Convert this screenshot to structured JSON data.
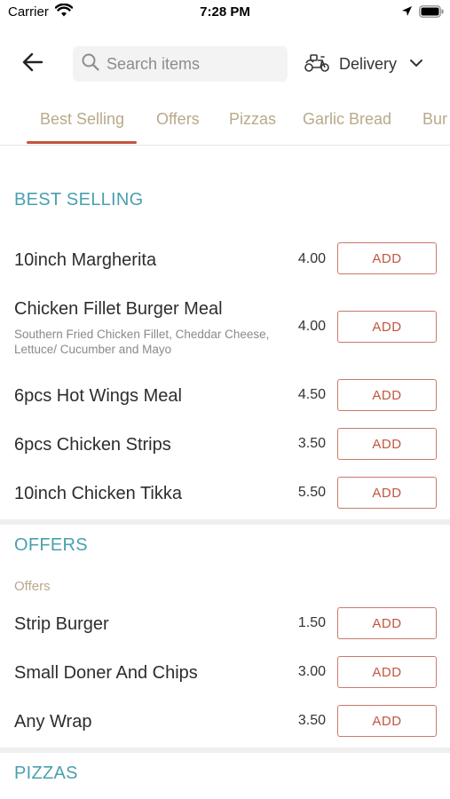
{
  "status_bar": {
    "carrier": "Carrier",
    "time": "7:28 PM",
    "icons": [
      "wifi-icon",
      "location-arrow-icon",
      "battery-icon"
    ]
  },
  "header": {
    "back_icon": "arrow-left-icon",
    "search": {
      "placeholder": "Search items",
      "value": "",
      "icon": "search-icon"
    },
    "delivery": {
      "label": "Delivery",
      "icon": "delivery-scooter-icon",
      "dropdown_icon": "chevron-down-icon"
    }
  },
  "tabs": [
    {
      "label": "Best Selling",
      "active": true
    },
    {
      "label": "Offers",
      "active": false
    },
    {
      "label": "Pizzas",
      "active": false
    },
    {
      "label": "Garlic Bread",
      "active": false
    },
    {
      "label": "Bur",
      "active": false
    }
  ],
  "sections": [
    {
      "title": "BEST SELLING",
      "items": [
        {
          "name": "10inch Margherita",
          "price": "4.00",
          "button": "ADD"
        },
        {
          "name": "Chicken Fillet Burger Meal",
          "description": "Southern Fried Chicken Fillet, Cheddar Cheese, Lettuce/ Cucumber and Mayo",
          "price": "4.00",
          "button": "ADD"
        },
        {
          "name": "6pcs Hot Wings Meal",
          "price": "4.50",
          "button": "ADD"
        },
        {
          "name": "6pcs Chicken Strips",
          "price": "3.50",
          "button": "ADD"
        },
        {
          "name": "10inch Chicken Tikka",
          "price": "5.50",
          "button": "ADD"
        }
      ]
    },
    {
      "title": "OFFERS",
      "subtitle": "Offers",
      "items": [
        {
          "name": "Strip Burger",
          "price": "1.50",
          "button": "ADD"
        },
        {
          "name": "Small Doner And Chips",
          "price": "3.00",
          "button": "ADD"
        },
        {
          "name": "Any Wrap",
          "price": "3.50",
          "button": "ADD"
        }
      ]
    },
    {
      "title": "PIZZAS",
      "items": []
    }
  ],
  "colors": {
    "section_title": "#4aa0ae",
    "tab_text": "#b9a98a",
    "accent": "#c2553f",
    "button_border": "#c97a68"
  }
}
